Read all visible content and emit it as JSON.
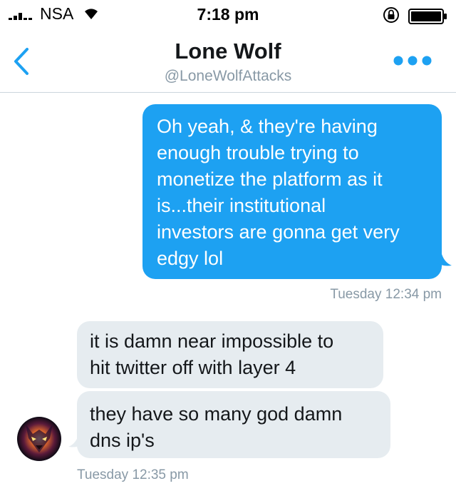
{
  "status_bar": {
    "carrier": "NSA",
    "time": "7:18 pm",
    "signal_icon": "signal-bars-icon",
    "wifi_icon": "wifi-icon",
    "lock_icon": "rotation-lock-icon",
    "battery_icon": "battery-icon",
    "battery_level": 1.0
  },
  "header": {
    "title": "Lone Wolf",
    "handle": "@LoneWolfAttacks",
    "back_icon": "chevron-left-icon",
    "more_icon": "more-dots-icon",
    "accent_color": "#1da1f2"
  },
  "messages": {
    "sent": {
      "text": "Oh yeah, & they're having enough trouble trying to monetize the platform as it is...their  institutional investors are gonna get very edgy lol",
      "lines": [
        "Oh yeah, & they're having",
        "enough trouble trying to",
        "monetize the platform as it",
        "is...their  institutional",
        "investors are gonna get very",
        "edgy lol"
      ],
      "timestamp": "Tuesday 12:34 pm",
      "bubble_color": "#1da1f2"
    },
    "received": [
      {
        "text": "it is damn near impossible to hit twitter off with layer 4",
        "lines": [
          "it is damn near impossible to",
          "hit twitter off with layer 4"
        ]
      },
      {
        "text": "they have so many god damn dns ip's",
        "lines": [
          "they have so many god damn",
          "dns ip's"
        ]
      }
    ],
    "received_timestamp": "Tuesday 12:35 pm",
    "received_bubble_color": "#e6ecf0"
  }
}
